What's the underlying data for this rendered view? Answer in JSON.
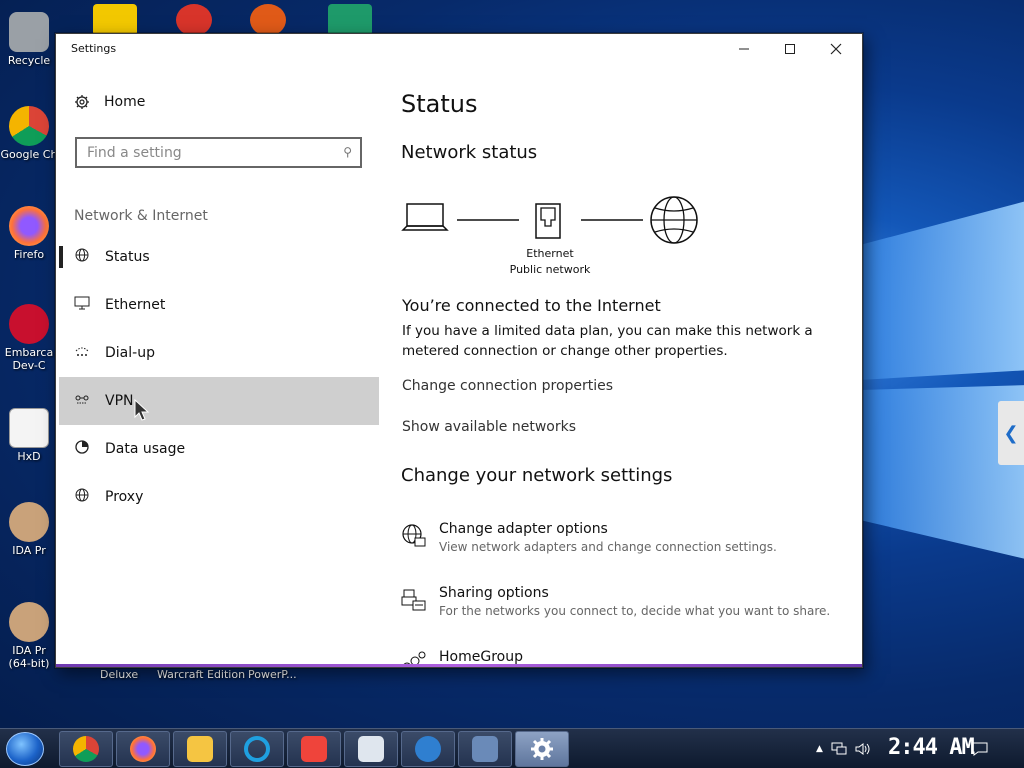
{
  "desktop": {
    "icons": [
      {
        "label": "Recycle"
      },
      {
        "label": "Google Ch"
      },
      {
        "label": "Firefo"
      },
      {
        "label": "Embarca Dev-C"
      },
      {
        "label": "HxD"
      },
      {
        "label": "IDA Pr"
      },
      {
        "label": "IDA Pr (64-bit)"
      }
    ],
    "bottom_labels": [
      "Deluxe",
      "Warcraft Edition",
      "PowerP..."
    ]
  },
  "window": {
    "title": "Settings",
    "controls": {
      "minimize": "—",
      "maximize": "☐",
      "close": "✕"
    }
  },
  "sidebar": {
    "home_label": "Home",
    "search_placeholder": "Find a setting",
    "section_label": "Network & Internet",
    "items": [
      {
        "label": "Status",
        "icon": "globe-icon"
      },
      {
        "label": "Ethernet",
        "icon": "monitor-icon"
      },
      {
        "label": "Dial-up",
        "icon": "dialup-icon"
      },
      {
        "label": "VPN",
        "icon": "vpn-icon"
      },
      {
        "label": "Data usage",
        "icon": "data-usage-icon"
      },
      {
        "label": "Proxy",
        "icon": "globe-icon"
      }
    ]
  },
  "main": {
    "title": "Status",
    "network_status_heading": "Network status",
    "diagram": {
      "connection_name": "Ethernet",
      "network_type": "Public network"
    },
    "connected_title": "You’re connected to the Internet",
    "connected_desc": "If you have a limited data plan, you can make this network a metered connection or change other properties.",
    "links": {
      "change_properties": "Change connection properties",
      "show_networks": "Show available networks"
    },
    "change_settings_heading": "Change your network settings",
    "options": [
      {
        "title": "Change adapter options",
        "subtitle": "View network adapters and change connection settings."
      },
      {
        "title": "Sharing options",
        "subtitle": "For the networks you connect to, decide what you want to share."
      },
      {
        "title": "HomeGroup",
        "subtitle": ""
      }
    ]
  },
  "taskbar": {
    "clock": "2:44 AM"
  }
}
